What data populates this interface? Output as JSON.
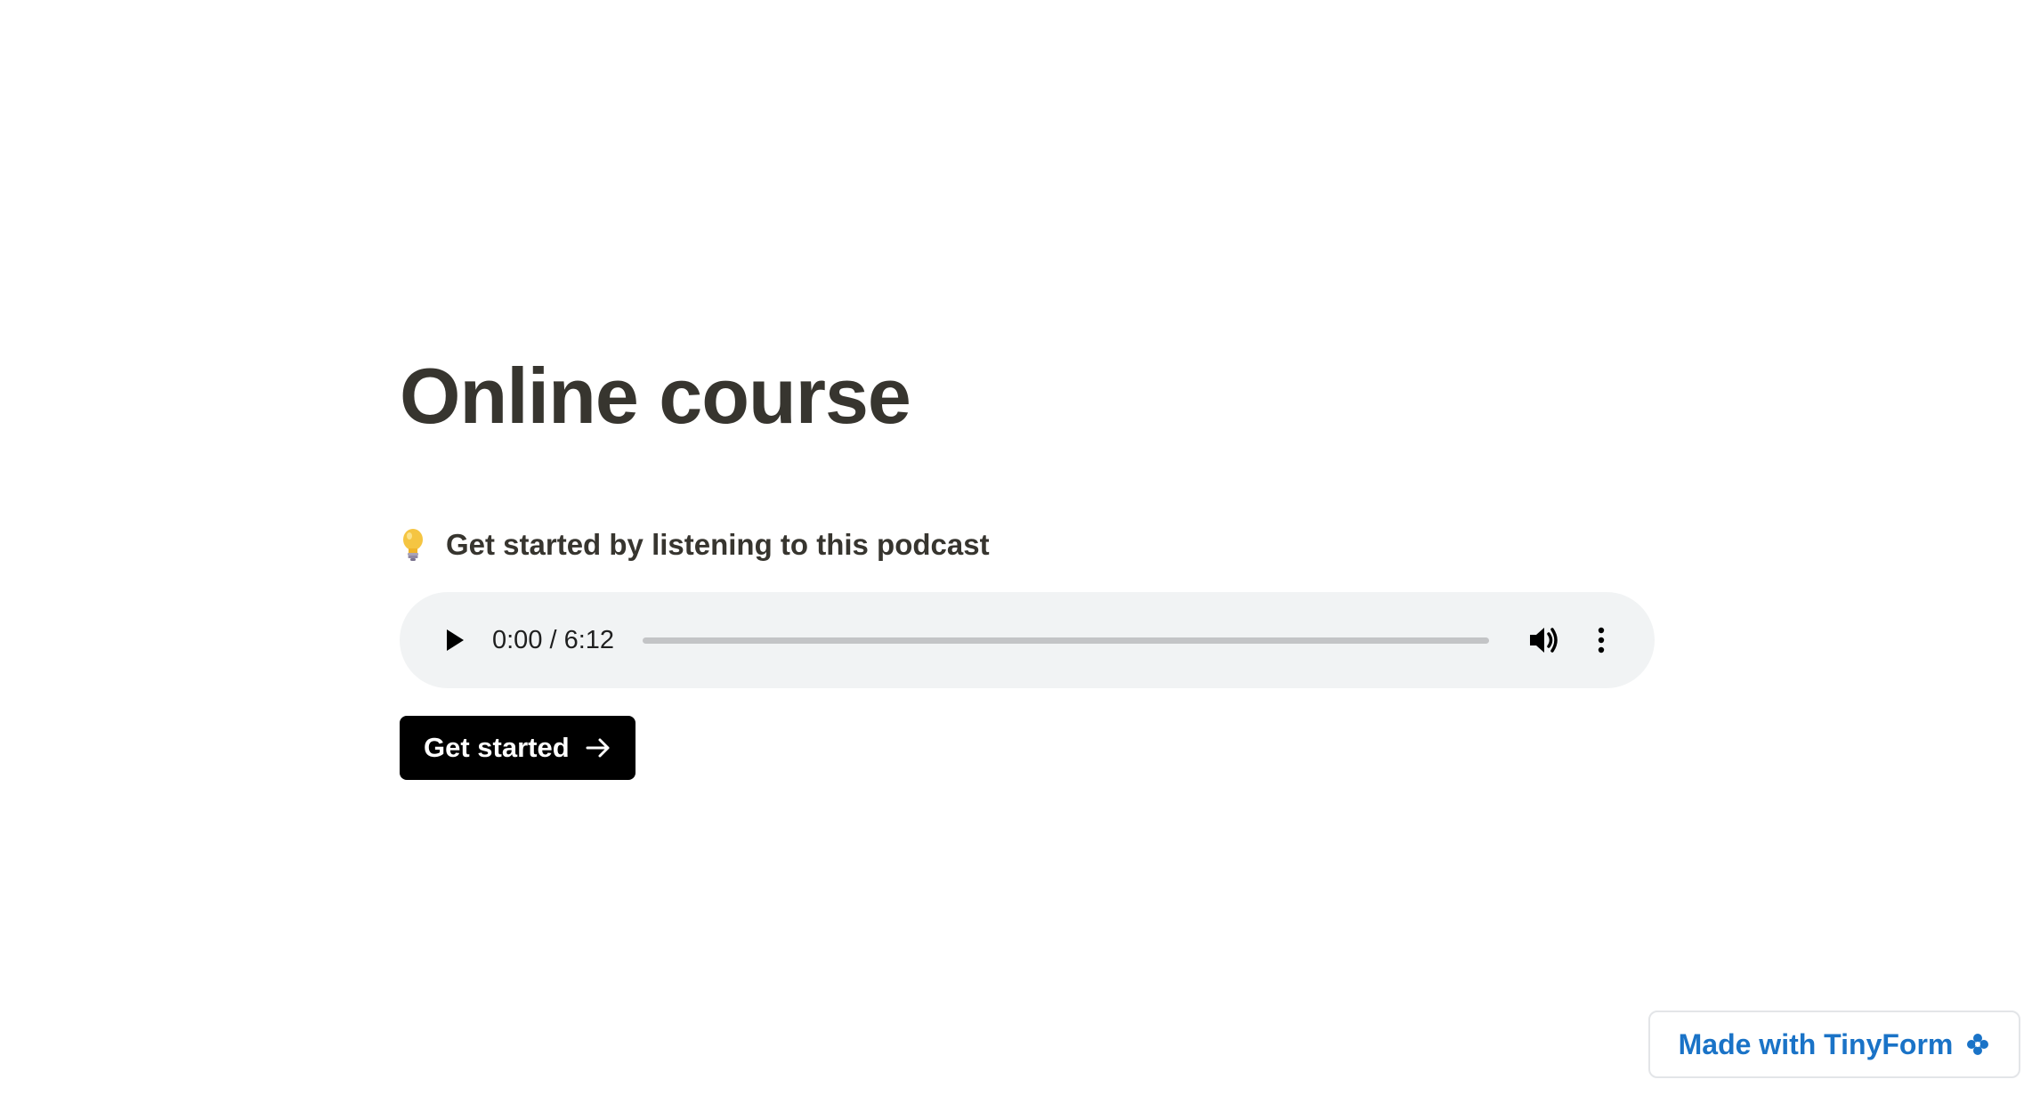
{
  "page": {
    "title": "Online course",
    "prompt": {
      "icon": "lightbulb-icon",
      "text": "Get started by listening to this podcast"
    },
    "audio": {
      "time": "0:00 / 6:12",
      "icons": [
        "play-icon",
        "volume-icon",
        "more-vert-icon"
      ],
      "progress": 0
    },
    "cta": {
      "label": "Get started",
      "icon": "arrow-right-icon"
    },
    "badge": {
      "label": "Made with TinyForm",
      "icon": "flower-icon"
    }
  },
  "colors": {
    "text": "#37352f",
    "button_bg": "#000000",
    "player_bg": "#f1f3f4",
    "badge_text": "#1a73c7"
  }
}
